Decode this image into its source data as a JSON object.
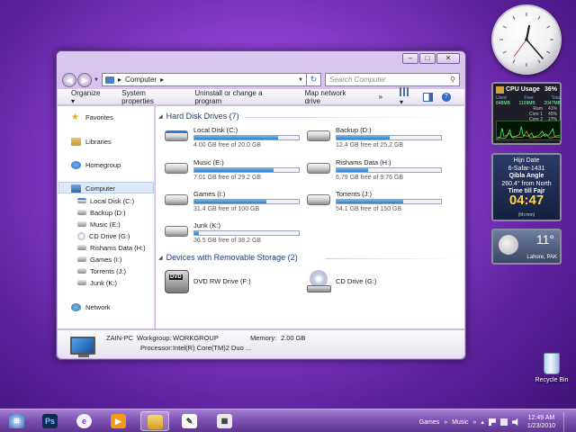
{
  "window": {
    "address": {
      "path": "Computer",
      "search_placeholder": "Search Computer"
    },
    "toolbar": {
      "organize": "Organize",
      "system_properties": "System properties",
      "uninstall": "Uninstall or change a program",
      "map_drive": "Map network drive",
      "more": "»"
    },
    "nav": {
      "favorites": "Favorites",
      "libraries": "Libraries",
      "homegroup": "Homegroup",
      "computer": "Computer",
      "drives": [
        "Local Disk (C:)",
        "Backup (D:)",
        "Music (E:)",
        "CD Drive (G:)",
        "Rishams Data (H:)",
        "Games (I:)",
        "Torrents (J:)",
        "Junk (K:)"
      ],
      "network": "Network"
    },
    "hdd_header": "Hard Disk Drives (7)",
    "hdd": [
      {
        "name": "Local Disk (C:)",
        "free": "4.00 GB free of 20.0 GB",
        "used_fraction": 0.8
      },
      {
        "name": "Backup (D:)",
        "free": "12.4 GB free of 25.2 GB",
        "used_fraction": 0.51
      },
      {
        "name": "Music (E:)",
        "free": "7.01 GB free of 29.2 GB",
        "used_fraction": 0.76
      },
      {
        "name": "Rishams Data (H:)",
        "free": "6.79 GB free of 9.76 GB",
        "used_fraction": 0.3
      },
      {
        "name": "Games (I:)",
        "free": "31.4 GB free of 100 GB",
        "used_fraction": 0.69
      },
      {
        "name": "Torrents (J:)",
        "free": "54.1 GB free of 150 GB",
        "used_fraction": 0.64
      },
      {
        "name": "Junk (K:)",
        "free": "36.5 GB free of 38.2 GB",
        "used_fraction": 0.04
      }
    ],
    "removable_header": "Devices with Removable Storage (2)",
    "removable": [
      {
        "name": "DVD RW Drive (F:)",
        "badge": "DVD"
      },
      {
        "name": "CD Drive (G:)"
      }
    ],
    "details": {
      "pc_name": "ZAIN-PC",
      "workgroup_label": "Workgroup:",
      "workgroup": "WORKGROUP",
      "memory_label": "Memory:",
      "memory": "2.00 GB",
      "processor_label": "Processor:",
      "processor": "Intel(R) Core(TM)2 Duo ..."
    }
  },
  "gadgets": {
    "cpu": {
      "title": "CPU Usage",
      "percent": "36%",
      "headers": [
        "Used",
        "Free",
        "Total"
      ],
      "values": [
        "848MB",
        "1199MB",
        "2047MB"
      ],
      "cores": [
        {
          "label": "Ram",
          "value": "41%"
        },
        {
          "label": "Core 1",
          "value": "45%"
        },
        {
          "label": "Core 2",
          "value": "27%"
        }
      ]
    },
    "hijri": {
      "title": "Hijri Date",
      "date": "6-Safar-1431",
      "qibla": "Qibla Angle",
      "angle": "260.4° from North",
      "prayer": "Time till Fajr",
      "countdown": "04:47",
      "format": "(hh:mm)"
    },
    "weather": {
      "temp": "11°",
      "location": "Lahore, PAK"
    },
    "recycle": "Recycle Bin"
  },
  "taskbar": {
    "apps": [
      "Ps",
      "e",
      "▶"
    ],
    "links": [
      "Games",
      "Music"
    ],
    "time": "12:49 AM",
    "date": "1/23/2010"
  }
}
